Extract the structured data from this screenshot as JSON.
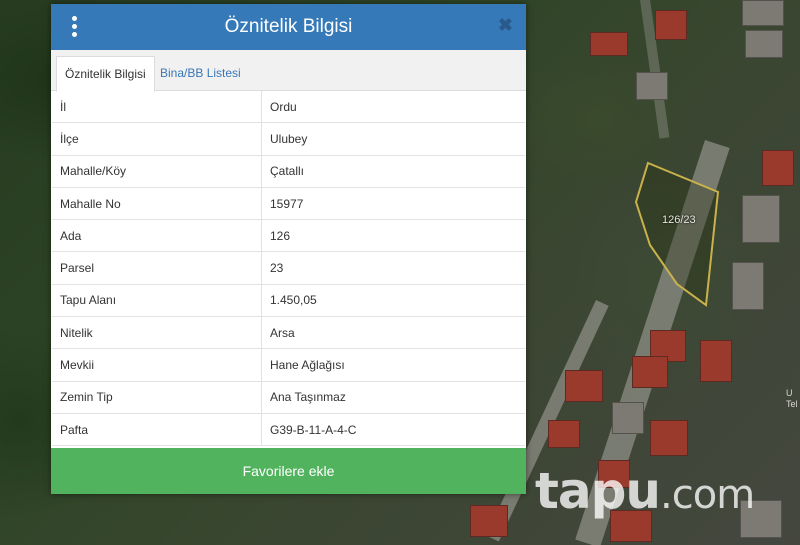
{
  "dialog": {
    "title": "Öznitelik Bilgisi",
    "close_glyph": "✖",
    "tabs": [
      {
        "label": "Öznitelik Bilgisi",
        "active": true
      },
      {
        "label": "Bina/BB Listesi",
        "active": false
      }
    ],
    "rows": [
      {
        "key": "İl",
        "value": "Ordu"
      },
      {
        "key": "İlçe",
        "value": "Ulubey"
      },
      {
        "key": "Mahalle/Köy",
        "value": "Çatallı"
      },
      {
        "key": "Mahalle No",
        "value": "15977"
      },
      {
        "key": "Ada",
        "value": "126"
      },
      {
        "key": "Parsel",
        "value": "23"
      },
      {
        "key": "Tapu Alanı",
        "value": "1.450,05"
      },
      {
        "key": "Nitelik",
        "value": "Arsa"
      },
      {
        "key": "Mevkii",
        "value": "Hane Ağlağısı"
      },
      {
        "key": "Zemin Tip",
        "value": "Ana Taşınmaz"
      },
      {
        "key": "Pafta",
        "value": "G39-B-11-A-4-C"
      }
    ],
    "favorite_button": "Favorilere ekle"
  },
  "map": {
    "parcel_label": "126/23",
    "edge_text": [
      "U",
      "Tel"
    ],
    "parcel_outline_color": "#c9b24a"
  },
  "watermark": {
    "main": "tapu",
    "suffix": ".com"
  },
  "colors": {
    "header": "#3579b8",
    "favorite_button": "#52b35e",
    "tab_link": "#3a77b6"
  },
  "icons": {
    "menu": "vertical-dots-icon",
    "close": "close-icon"
  }
}
